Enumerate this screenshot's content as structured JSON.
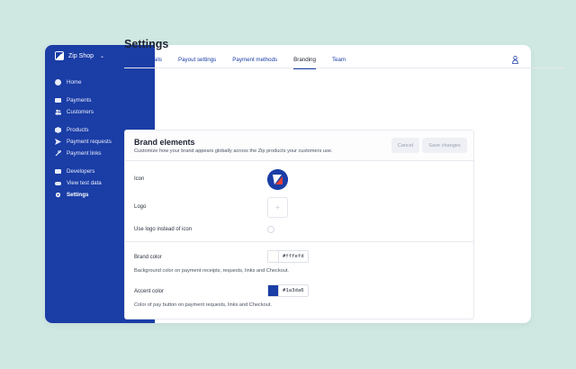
{
  "sidebar": {
    "shop_name": "Zip Shop",
    "items": [
      {
        "label": "Home",
        "icon": "home-icon"
      },
      {
        "label": "Payments",
        "icon": "payments-icon"
      },
      {
        "label": "Customers",
        "icon": "customers-icon"
      },
      {
        "label": "Products",
        "icon": "products-icon"
      },
      {
        "label": "Payment requests",
        "icon": "send-icon"
      },
      {
        "label": "Payment links",
        "icon": "link-icon"
      },
      {
        "label": "Developers",
        "icon": "developers-icon"
      },
      {
        "label": "View test data",
        "icon": "toggle-icon"
      },
      {
        "label": "Settings",
        "icon": "gear-icon"
      }
    ]
  },
  "page": {
    "title": "Settings",
    "tabs": [
      "Account details",
      "Payout settings",
      "Payment methods",
      "Branding",
      "Team"
    ],
    "active_tab": "Branding"
  },
  "card": {
    "title": "Brand elements",
    "description": "Customize how your brand appears globally across the Zip products your customers use.",
    "cancel_label": "Cancel",
    "save_label": "Save changes",
    "icon_label": "Icon",
    "logo_label": "Logo",
    "use_logo_label": "Use logo instead of icon",
    "brand_color_label": "Brand color",
    "brand_color_value": "#fffefd",
    "brand_color_help": "Background color on payment receipts, requests, links and Checkout.",
    "accent_color_label": "Accent color",
    "accent_color_value": "#1a3da6",
    "accent_color_help": "Color of pay button on payment requests, links and Checkout."
  },
  "colors": {
    "sidebar_bg": "#1a3da6",
    "page_bg": "#cfe8e2",
    "accent": "#1a3da6"
  }
}
